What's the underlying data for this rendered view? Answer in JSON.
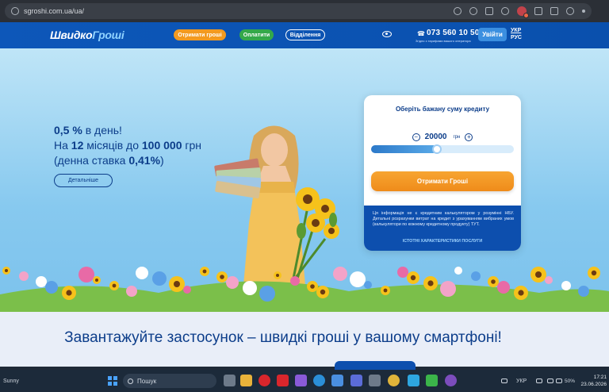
{
  "browser": {
    "url": "sgroshi.com.ua/ua/"
  },
  "header": {
    "logo_main": "Швидко",
    "logo_accent": "Гроші",
    "btn_get_money": "Отримати гроші",
    "btn_pay": "Оплатити",
    "btn_branches": "Відділення",
    "phone": "073 560 10 50",
    "phone_note": "Згідно з тарифами вашого оператора",
    "btn_login": "Увійти",
    "lang_uk": "УКР",
    "lang_ru": "РУС",
    "colors": {
      "header_bg": "#0d57b9",
      "orange": "#f39a1f",
      "green": "#34a84a",
      "login_bg": "#3b8fe0"
    }
  },
  "hero": {
    "line1_rate": "0,5 %",
    "line1_rest": " в день!",
    "line2_prefix": "На ",
    "line2_months": "12",
    "line2_mid": " місяців до ",
    "line2_amount": "100 000",
    "line2_suffix": " грн",
    "line3_prefix": "(денна ставка ",
    "line3_rate": "0,41%",
    "line3_suffix": ")",
    "btn_more": "Детальніше"
  },
  "calculator": {
    "title": "Оберіть бажану суму кредиту",
    "amount": "20000",
    "unit": "грн",
    "minus": "−",
    "plus": "+",
    "slider_fraction": 0.46,
    "btn_label": "Отримати Гроші",
    "note": "Ця інформація не є кредитним калькулятором у розумінні НБУ. Детальні розрахунки витрат на кредит з урахуванням вибраних умов (калькулятори по кожному кредитному продукту) ТУТ.",
    "link": "ІСТОТНІ ХАРАКТЕРИСТИКИ ПОСЛУГИ"
  },
  "promo": {
    "title": "Завантажуйте застосунок – швидкі гроші у вашому смартфоні!"
  },
  "taskbar": {
    "weather": "Sunny",
    "search_placeholder": "Пошук",
    "lang": "УКР",
    "battery": "50%",
    "time": "17:21",
    "date": "23.06.2026"
  }
}
